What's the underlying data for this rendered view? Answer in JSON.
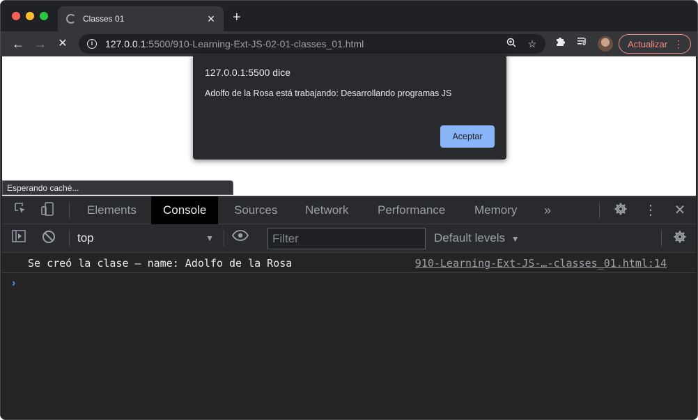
{
  "tab": {
    "title": "Classes 01"
  },
  "toolbar": {
    "url_host": "127.0.0.1",
    "url_rest": ":5500/910-Learning-Ext-JS-02-01-classes_01.html",
    "update_label": "Actualizar"
  },
  "dialog": {
    "title": "127.0.0.1:5500 dice",
    "message": "Adolfo de la Rosa está trabajando: Desarrollando programas JS",
    "ok_label": "Aceptar"
  },
  "status": {
    "text": "Esperando caché..."
  },
  "devtools": {
    "tabs": [
      "Elements",
      "Console",
      "Sources",
      "Network",
      "Performance",
      "Memory"
    ],
    "active_tab": "Console",
    "context": "top",
    "filter_placeholder": "Filter",
    "levels": "Default levels",
    "console": [
      {
        "message": "Se creó la clase – name: Adolfo de la Rosa",
        "source": "910-Learning-Ext-JS-…-classes_01.html:14"
      }
    ]
  },
  "colors": {
    "accent": "#8ab4f8",
    "update": "#f28b82",
    "prompt": "#4d8ef7"
  }
}
